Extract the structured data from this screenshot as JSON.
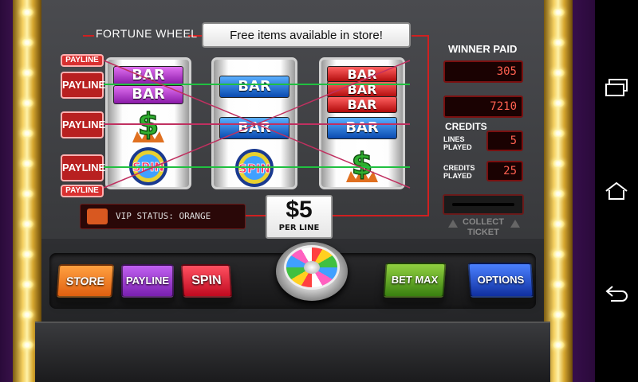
{
  "header": {
    "title": "FORTUNE WHEEL",
    "promo": "Free items available in store!"
  },
  "paylines": {
    "small": "PAYLINE",
    "big": "PAYLINE"
  },
  "reels": [
    {
      "top": "BAR",
      "top2": "BAR",
      "middle": "dollar",
      "bottom": "SPIN"
    },
    {
      "top": "BAR",
      "middle": "BAR",
      "bottom": "SPIN"
    },
    {
      "top": [
        "BAR",
        "BAR",
        "BAR"
      ],
      "middle": "BAR",
      "bottom": "dollar"
    }
  ],
  "right_panel": {
    "winner_paid_label": "WINNER PAID",
    "winner_paid": "305",
    "credits": "7210",
    "credits_label": "CREDITS",
    "lines_played_label_1": "LINES",
    "lines_played_label_2": "PLAYED",
    "lines_played": "5",
    "credits_played_label_1": "CREDITS",
    "credits_played_label_2": "PLAYED",
    "credits_played": "25"
  },
  "vip": {
    "text": "VIP STATUS: ORANGE"
  },
  "bet": {
    "value": "$5",
    "sub": "PER LINE"
  },
  "collect": {
    "line1": "COLLECT",
    "line2": "TICKET"
  },
  "buttons": {
    "store": "STORE",
    "payline": "PAYLINE",
    "spin": "SPIN",
    "bet_max": "BET MAX",
    "options": "OPTIONS"
  },
  "colors": {
    "store": "#f07820",
    "payline": "#9a30d0",
    "spin": "#e02030",
    "bet_max": "#5aa020",
    "options": "#2050c0"
  },
  "nav": {
    "icons": [
      "recent-apps-icon",
      "home-icon",
      "back-icon"
    ]
  }
}
